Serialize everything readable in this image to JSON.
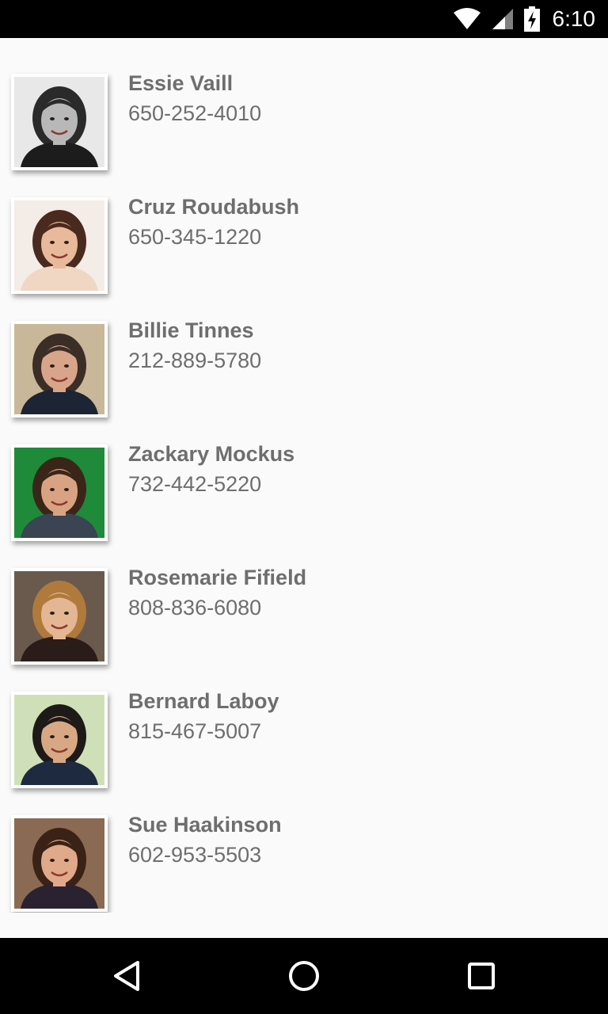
{
  "status_bar": {
    "time": "6:10",
    "icons": [
      "wifi-icon",
      "cell-signal-icon",
      "battery-charging-icon"
    ]
  },
  "contacts": [
    {
      "name": "Essie Vaill",
      "phone": "650-252-4010",
      "photo": "woman-portrait-grayscale",
      "bg": "#e8e8e8",
      "skin": "#b8b8b8",
      "hair": "#2a2a2a",
      "shirt": "#1c1c1c"
    },
    {
      "name": "Cruz Roudabush",
      "phone": "650-345-1220",
      "photo": "woman-portrait-smiling",
      "bg": "#f4ece6",
      "skin": "#e9b99b",
      "hair": "#4a2a1e",
      "shirt": "#f0d7c4"
    },
    {
      "name": "Billie Tinnes",
      "phone": "212-889-5780",
      "photo": "man-portrait-suit-glasses",
      "bg": "#c9b79a",
      "skin": "#d9a58a",
      "hair": "#3b2e26",
      "shirt": "#1d2433"
    },
    {
      "name": "Zackary Mockus",
      "phone": "732-442-5220",
      "photo": "man-portrait-green-background",
      "bg": "#1f8a3a",
      "skin": "#d9a383",
      "hair": "#3a2618",
      "shirt": "#3a4452"
    },
    {
      "name": "Rosemarie Fifield",
      "phone": "808-836-6080",
      "photo": "woman-portrait-blonde",
      "bg": "#6a5a4e",
      "skin": "#e4b694",
      "hair": "#b07a3c",
      "shirt": "#2a1c18"
    },
    {
      "name": "Bernard Laboy",
      "phone": "815-467-5007",
      "photo": "man-portrait-outdoor",
      "bg": "#cfe0b8",
      "skin": "#d8a884",
      "hair": "#1e1a18",
      "shirt": "#1e2a40"
    },
    {
      "name": "Sue Haakinson",
      "phone": "602-953-5503",
      "photo": "woman-portrait-brunette",
      "bg": "#8a6a52",
      "skin": "#e0a98a",
      "hair": "#3a2216",
      "shirt": "#2a2230"
    }
  ],
  "nav_bar": {
    "icons": [
      "back-icon",
      "home-icon",
      "recents-icon"
    ]
  }
}
